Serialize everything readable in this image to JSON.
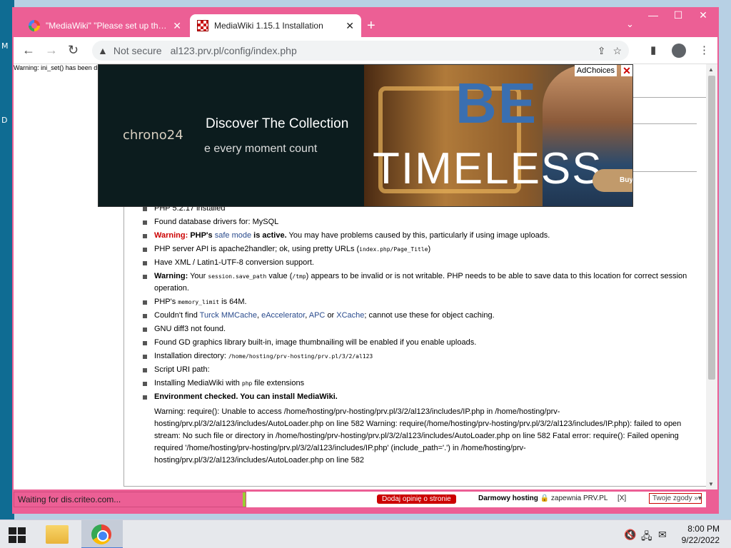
{
  "desktop": {
    "frag1": "M",
    "frag2": "D"
  },
  "browser": {
    "tabs": [
      {
        "title": "\"MediaWiki\" \"Please set up the wiki first\""
      },
      {
        "title": "MediaWiki 1.15.1 Installation"
      }
    ],
    "window_controls": {
      "minimize": "—",
      "maximize": "☐",
      "close": "✕"
    },
    "new_tab": "+",
    "tab_menu": "⌄",
    "security": "Not secure",
    "url": "al123.prv.pl/config/index.php"
  },
  "page": {
    "ini_warning": "Warning: ini_set() has been disabled",
    "checks": [
      {
        "text": "PHP 5.2.17 installed"
      },
      {
        "text": "Found database drivers for: MySQL"
      }
    ],
    "safe_mode": {
      "warn": "Warning:",
      "a": "PHP's",
      "link": "safe mode",
      "b": "is active.",
      "c": "You may have problems caused by this, particularly if using image uploads."
    },
    "server_api": {
      "a": "PHP server API is apache2handler; ok, using pretty URLs (",
      "code": "index.php/Page_Title",
      "b": ")"
    },
    "xml": "Have XML / Latin1-UTF-8 conversion support.",
    "session": {
      "warn": "Warning:",
      "a": "Your",
      "code1": "session.save_path",
      "b": "value (",
      "code2": "/tmp",
      "c": ") appears to be invalid or is not writable. PHP needs to be able to save data to this location for correct session operation."
    },
    "memory": {
      "a": "PHP's",
      "code": "memory_limit",
      "b": "is 64M."
    },
    "cache": {
      "a": "Couldn't find",
      "l1": "Turck MMCache",
      "s1": ",",
      "l2": "eAccelerator",
      "s2": ",",
      "l3": "APC",
      "s3": "or",
      "l4": "XCache",
      "b": "; cannot use these for object caching."
    },
    "diff": "GNU diff3 not found.",
    "gd": "Found GD graphics library built-in, image thumbnailing will be enabled if you enable uploads.",
    "install_dir": {
      "a": "Installation directory:",
      "code": "/home/hosting/prv-hosting/prv.pl/3/2/al123"
    },
    "script_uri": "Script URI path:",
    "ext": {
      "a": "Installing MediaWiki with",
      "code": "php",
      "b": "file extensions"
    },
    "ok": "Environment checked. You can install MediaWiki.",
    "error": "Warning: require(): Unable to access /home/hosting/prv-hosting/prv.pl/3/2/al123/includes/IP.php in /home/hosting/prv-hosting/prv.pl/3/2/al123/includes/AutoLoader.php on line 582 Warning: require(/home/hosting/prv-hosting/prv.pl/3/2/al123/includes/IP.php): failed to open stream: No such file or directory in /home/hosting/prv-hosting/prv.pl/3/2/al123/includes/AutoLoader.php on line 582 Fatal error: require(): Failed opening required '/home/hosting/prv-hosting/prv.pl/3/2/al123/includes/IP.php' (include_path='.') in /home/hosting/prv-hosting/prv.pl/3/2/al123/includes/AutoLoader.php on line 582"
  },
  "ad": {
    "logo": "chrono24",
    "title": "Discover The Collection",
    "subtitle": "e every moment count",
    "headline1": "BE",
    "headline2": "TIMELESS",
    "buy": "Buy",
    "adchoices": "AdChoices",
    "close": "✕"
  },
  "status": {
    "text": "Waiting for dis.criteo.com..."
  },
  "footer": {
    "dodaj": "Dodaj opinię o stronie",
    "darmowy": "Darmowy hosting",
    "zapewnia": "zapewnia PRV.PL",
    "x": "[X]",
    "zgody": "Twoje zgody »"
  },
  "taskbar": {
    "time": "8:00 PM",
    "date": "9/22/2022"
  }
}
